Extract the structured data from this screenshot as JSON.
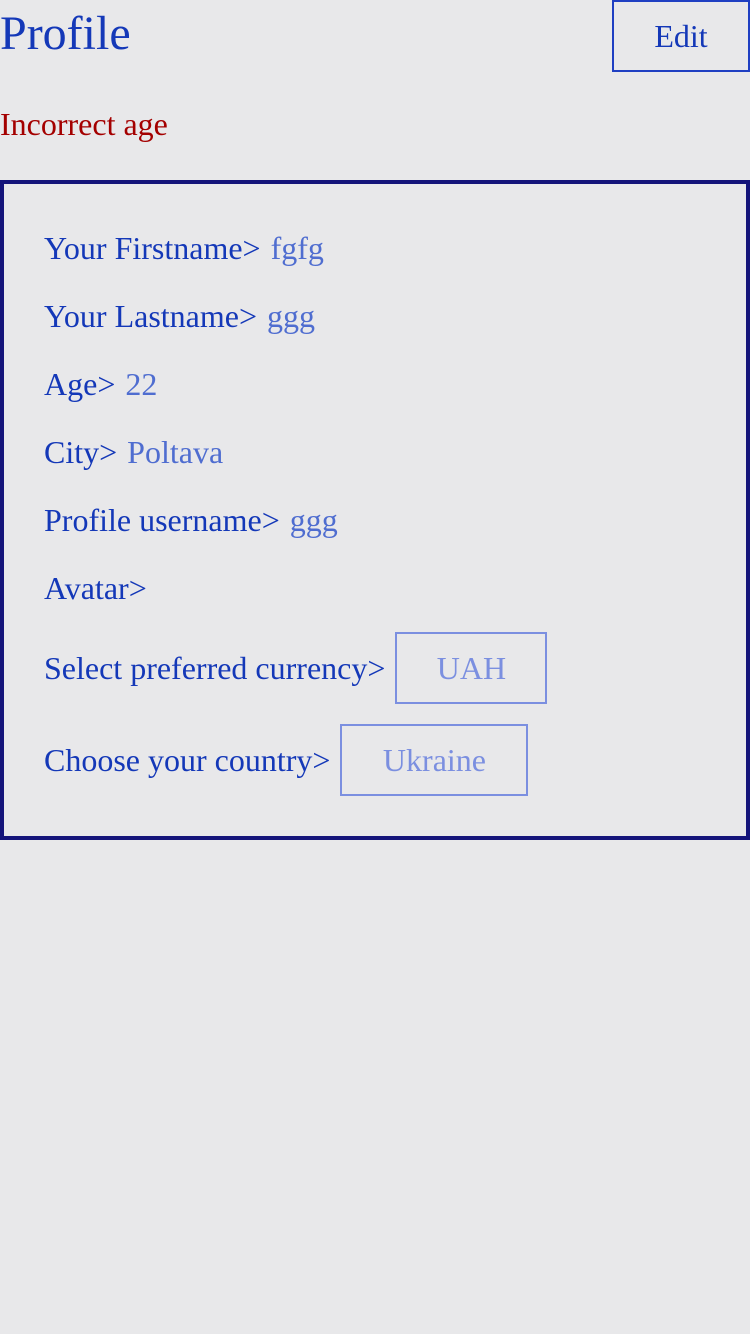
{
  "header": {
    "title": "Profile",
    "edit_label": "Edit"
  },
  "error_message": "Incorrect age",
  "profile": {
    "firstname": {
      "label": "Your Firstname>",
      "value": "fgfg"
    },
    "lastname": {
      "label": "Your Lastname>",
      "value": "ggg"
    },
    "age": {
      "label": "Age>",
      "value": "22"
    },
    "city": {
      "label": "City>",
      "value": "Poltava"
    },
    "username": {
      "label": "Profile username>",
      "value": "ggg"
    },
    "avatar": {
      "label": "Avatar>"
    },
    "currency": {
      "label": "Select preferred currency>",
      "value": "UAH"
    },
    "country": {
      "label": "Choose your country>",
      "value": "Ukraine"
    }
  },
  "colors": {
    "background": "#e8e8ea",
    "primary_text": "#1438b8",
    "value_text": "#4f6dd0",
    "error_text": "#a40000",
    "card_border": "#14147a",
    "select_border": "#7b8fe0"
  }
}
